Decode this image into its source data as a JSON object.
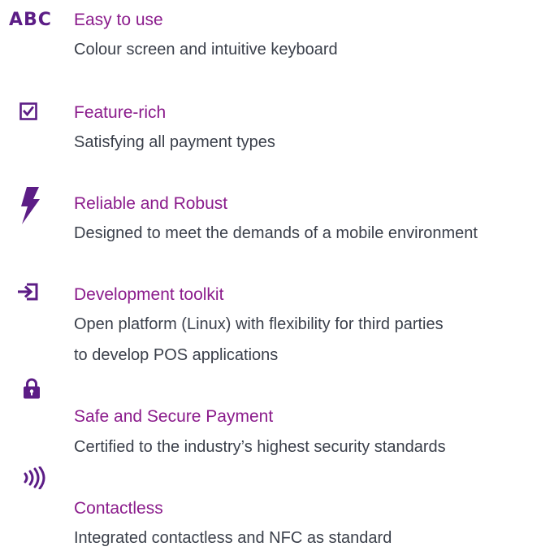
{
  "features": [
    {
      "icon": "abc-text-icon",
      "icon_text": "ABC",
      "title": "Easy to use",
      "description": [
        "Colour screen and intuitive keyboard"
      ]
    },
    {
      "icon": "checkbox-checked-icon",
      "title": "Feature-rich",
      "description": [
        "Satisfying all payment types"
      ]
    },
    {
      "icon": "lightning-bolt-icon",
      "title": "Reliable and Robust",
      "description": [
        "Designed to meet the demands of a mobile environment"
      ]
    },
    {
      "icon": "arrow-into-box-icon",
      "title": "Development toolkit",
      "description": [
        "Open platform (Linux) with flexibility for third parties",
        "to develop POS applications"
      ]
    },
    {
      "icon": "padlock-icon",
      "title": "Safe and Secure Payment",
      "description": [
        "Certified to the industry’s highest security standards"
      ]
    },
    {
      "icon": "contactless-icon",
      "title": "Contactless",
      "description": [
        "Integrated contactless and NFC as standard"
      ]
    }
  ],
  "colors": {
    "icon": "#5c1d86",
    "title": "#8b1c8c",
    "text": "#3a3f4a"
  }
}
